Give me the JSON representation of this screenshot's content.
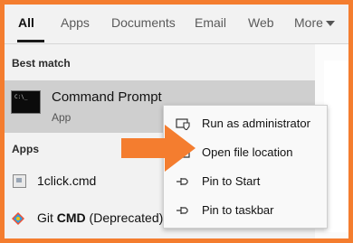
{
  "tabs": [
    {
      "label": "All",
      "active": true
    },
    {
      "label": "Apps"
    },
    {
      "label": "Documents"
    },
    {
      "label": "Email"
    },
    {
      "label": "Web"
    },
    {
      "label": "More"
    }
  ],
  "sections": {
    "best_match": "Best match",
    "apps": "Apps"
  },
  "best_match_item": {
    "icon_text": "C:\\_",
    "title": "Command Prompt",
    "subtitle": "App"
  },
  "apps": [
    {
      "name": "1click.cmd",
      "icon": "file-icon"
    },
    {
      "name_prefix": "Git ",
      "name_bold": "CMD",
      "name_suffix": " (Deprecated)",
      "icon": "git-icon"
    }
  ],
  "context_menu": [
    {
      "label": "Run as administrator",
      "icon": "shield-icon"
    },
    {
      "label": "Open file location",
      "icon": "folder-icon"
    },
    {
      "label": "Pin to Start",
      "icon": "pin-icon"
    },
    {
      "label": "Pin to taskbar",
      "icon": "pin-icon"
    }
  ],
  "colors": {
    "annotation_orange": "#f47d2f",
    "selection": "#cfcfcf"
  }
}
